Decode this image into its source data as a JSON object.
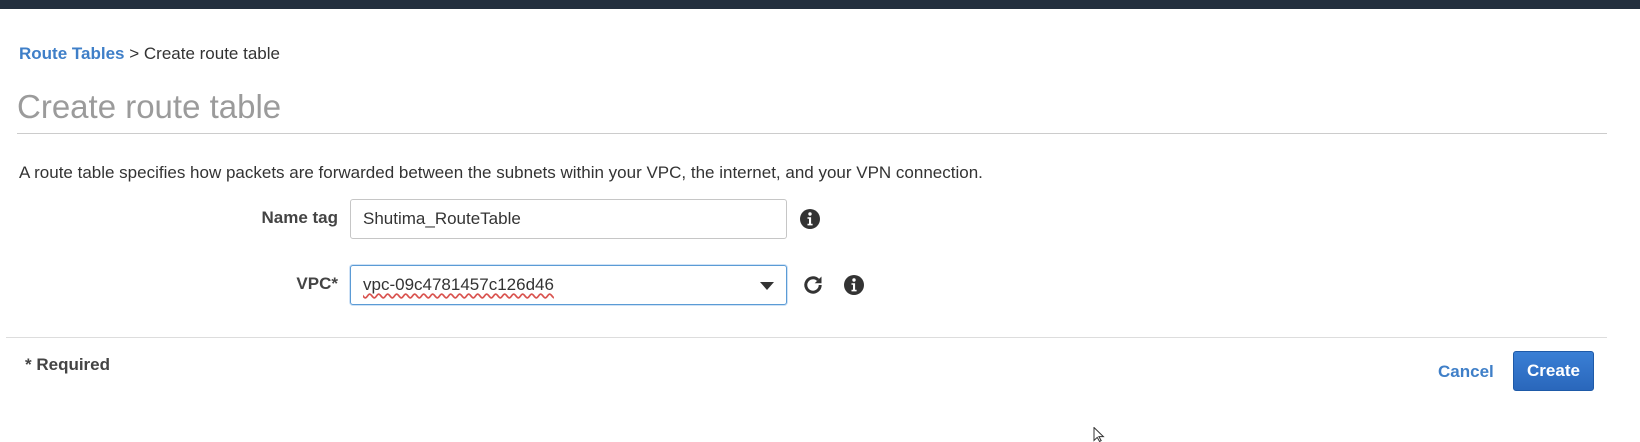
{
  "breadcrumb": {
    "parent": "Route Tables",
    "separator": ">",
    "current": "Create route table"
  },
  "page": {
    "title": "Create route table",
    "description": "A route table specifies how packets are forwarded between the subnets within your VPC, the internet, and your VPN connection."
  },
  "form": {
    "name_tag": {
      "label": "Name tag",
      "value": "Shutima_RouteTable"
    },
    "vpc": {
      "label": "VPC*",
      "value": "vpc-09c4781457c126d46"
    }
  },
  "footer": {
    "required_note": "* Required",
    "cancel_label": "Cancel",
    "create_label": "Create"
  },
  "icons": {
    "info": "info-circle-icon",
    "refresh": "refresh-icon",
    "dropdown": "caret-down-icon",
    "cursor": "mouse-pointer-icon"
  },
  "colors": {
    "topbar": "#232f3e",
    "link": "#3f7fc8",
    "primary_button": "#2e6fc4",
    "title": "#9b9b9b"
  }
}
